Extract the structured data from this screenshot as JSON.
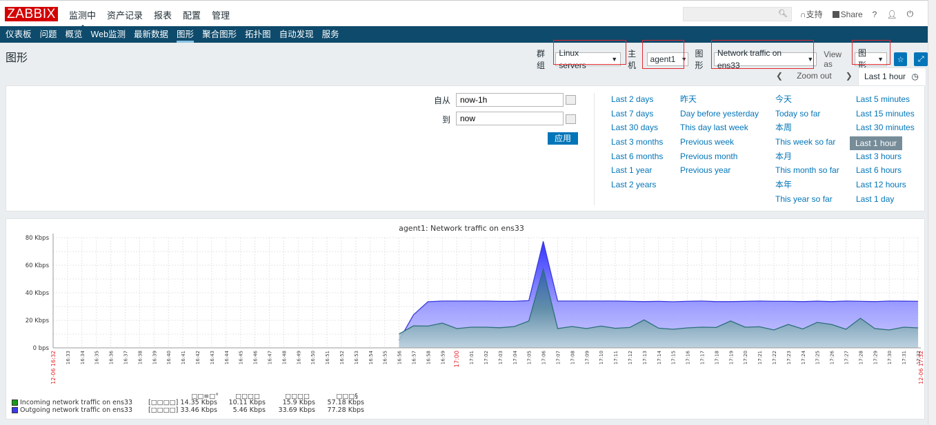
{
  "topbar": {
    "logo": "ZABBIX",
    "menu": [
      "监测中",
      "资产记录",
      "报表",
      "配置",
      "管理"
    ],
    "active_menu": "监测中",
    "search_placeholder": "",
    "support": "支持",
    "share": "Share",
    "help": "?"
  },
  "subnav": {
    "items": [
      "仪表板",
      "问题",
      "概览",
      "Web监测",
      "最新数据",
      "图形",
      "聚合图形",
      "拓扑图",
      "自动发现",
      "服务"
    ],
    "active": "图形"
  },
  "header": {
    "title": "图形",
    "group_label": "群组",
    "group_value": "Linux servers",
    "host_label": "主机",
    "host_value": "agent1",
    "graph_label": "图形",
    "graph_value": "Network traffic on ens33",
    "viewas_label": "View as",
    "viewas_value": "图形"
  },
  "timebar": {
    "zoom_out": "Zoom out",
    "current_range": "Last 1 hour"
  },
  "filter": {
    "from_label": "自从",
    "from_value": "now-1h",
    "to_label": "到",
    "to_value": "now",
    "apply": "应用",
    "quick_col1": [
      "Last 2 days",
      "Last 7 days",
      "Last 30 days",
      "Last 3 months",
      "Last 6 months",
      "Last 1 year",
      "Last 2 years"
    ],
    "quick_col2": [
      "昨天",
      "Day before yesterday",
      "This day last week",
      "Previous week",
      "Previous month",
      "Previous year"
    ],
    "quick_col3": [
      "今天",
      "Today so far",
      "本周",
      "This week so far",
      "本月",
      "This month so far",
      "本年",
      "This year so far"
    ],
    "quick_col4": [
      "Last 5 minutes",
      "Last 15 minutes",
      "Last 30 minutes",
      "Last 1 hour",
      "Last 3 hours",
      "Last 6 hours",
      "Last 12 hours",
      "Last 1 day"
    ],
    "selected_quick": "Last 1 hour"
  },
  "chart_data": {
    "type": "area",
    "title": "agent1: Network traffic on ens33",
    "ylabel": "",
    "xlabel": "",
    "ylim": [
      0,
      80
    ],
    "y_ticks": [
      "0 bps",
      "20 Kbps",
      "40 Kbps",
      "60 Kbps",
      "80 Kbps"
    ],
    "x_start_label": "12-06 16:32",
    "x_end_label": "12-06 17:32",
    "x_ticks": [
      "16:33",
      "16:34",
      "16:35",
      "16:36",
      "16:37",
      "16:38",
      "16:39",
      "16:40",
      "16:41",
      "16:42",
      "16:43",
      "16:44",
      "16:45",
      "16:46",
      "16:47",
      "16:48",
      "16:49",
      "16:50",
      "16:51",
      "16:52",
      "16:53",
      "16:54",
      "16:55",
      "16:56",
      "16:57",
      "16:58",
      "16:59",
      "17:00",
      "17:01",
      "17:02",
      "17:03",
      "17:04",
      "17:05",
      "17:06",
      "17:07",
      "17:08",
      "17:09",
      "17:10",
      "17:11",
      "17:12",
      "17:13",
      "17:14",
      "17:15",
      "17:16",
      "17:17",
      "17:18",
      "17:19",
      "17:20",
      "17:21",
      "17:22",
      "17:23",
      "17:24",
      "17:25",
      "17:26",
      "17:27",
      "17:28",
      "17:29",
      "17:30",
      "17:31",
      "17:32"
    ],
    "highlight_tick": "17:00",
    "x_minutes": [
      24,
      25,
      26,
      27,
      28,
      29,
      30,
      31,
      32,
      33,
      34,
      35,
      36,
      37,
      38,
      39,
      40,
      41,
      42,
      43,
      44,
      45,
      46,
      47,
      48,
      49,
      50,
      51,
      52,
      53,
      54,
      55,
      56,
      57,
      58,
      59,
      60
    ],
    "series": [
      {
        "name": "Outgoing network traffic on ens33",
        "color": "#3333ff",
        "values": [
          5.5,
          24,
          33.5,
          34,
          34,
          34,
          34,
          33.8,
          33.8,
          34.3,
          77.3,
          34,
          34,
          34,
          34,
          34,
          33.8,
          33.6,
          33.8,
          33.5,
          33.8,
          34,
          33.6,
          33.6,
          33.8,
          34,
          33.8,
          33.8,
          33.6,
          33.9,
          33.6,
          34,
          33.8,
          33.6,
          34,
          33.9,
          33.8
        ]
      },
      {
        "name": "Incoming network traffic on ens33",
        "color": "#1a8a1a",
        "values": [
          10.1,
          16,
          15.8,
          18,
          14,
          15,
          15,
          14.6,
          15.5,
          19.5,
          57.2,
          14,
          15.5,
          14,
          15.8,
          14.2,
          14.8,
          20.3,
          14.3,
          13.5,
          14.5,
          15,
          14.8,
          19.5,
          15,
          15.3,
          13,
          17,
          13.7,
          18.5,
          17,
          13.5,
          21.5,
          14,
          13,
          15,
          14.5
        ]
      }
    ],
    "legend": {
      "headers": [
        "□□≡□°",
        "□□□□",
        "□□□□",
        "□□□§"
      ],
      "rows": [
        {
          "color": "#1a9a1a",
          "name": "Incoming network traffic on ens33",
          "func": "[□□□□]",
          "last": "14.35 Kbps",
          "min": "10.11 Kbps",
          "avg": "15.9 Kbps",
          "max": "57.18 Kbps"
        },
        {
          "color": "#3a3aee",
          "name": "Outgoing network traffic on ens33",
          "func": "[□□□□]",
          "last": "33.46 Kbps",
          "min": "5.46 Kbps",
          "avg": "33.69 Kbps",
          "max": "77.28 Kbps"
        }
      ]
    }
  }
}
